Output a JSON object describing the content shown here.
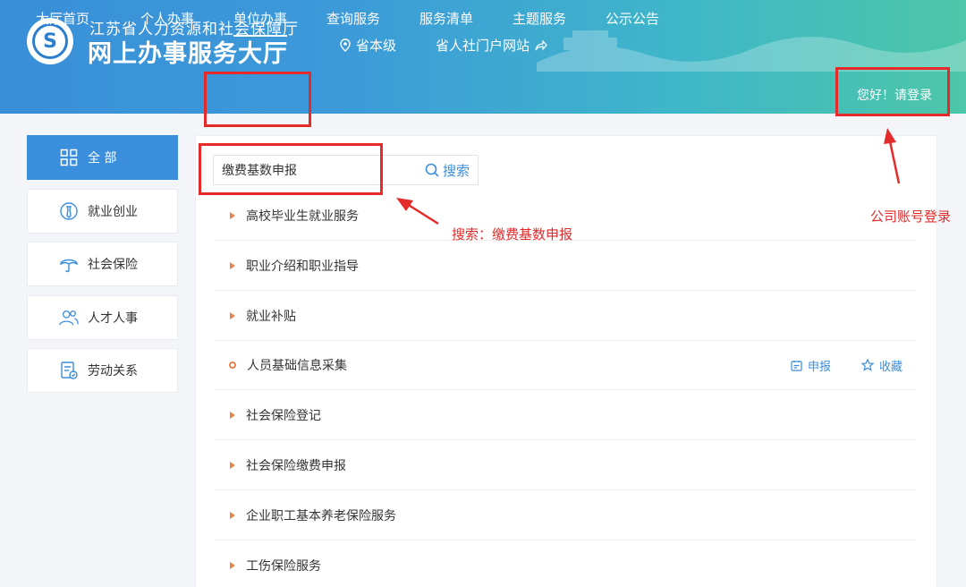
{
  "header": {
    "title_small": "江苏省人力资源和社会保障厅",
    "title_big": "网上办事服务大厅",
    "region": "省本级",
    "portal": "省人社门户网站",
    "login": "您好！请登录"
  },
  "nav": {
    "items": [
      "大厅首页",
      "个人办事",
      "单位办事",
      "查询服务",
      "服务清单",
      "主题服务",
      "公示公告"
    ],
    "active": "单位办事"
  },
  "sidebar": {
    "items": [
      {
        "label": "全 部",
        "icon": "grid-icon",
        "active": true
      },
      {
        "label": "就业创业",
        "icon": "employment-icon",
        "active": false
      },
      {
        "label": "社会保险",
        "icon": "umbrella-icon",
        "active": false
      },
      {
        "label": "人才人事",
        "icon": "people-icon",
        "active": false
      },
      {
        "label": "劳动关系",
        "icon": "document-icon",
        "active": false
      }
    ]
  },
  "search": {
    "value": "缴费基数申报",
    "button": "搜索"
  },
  "list": {
    "items": [
      {
        "label": "高校毕业生就业服务",
        "expandable": true
      },
      {
        "label": "职业介绍和职业指导",
        "expandable": true
      },
      {
        "label": "就业补贴",
        "expandable": true
      },
      {
        "label": "人员基础信息采集",
        "expandable": false,
        "actions": [
          "申报",
          "收藏"
        ]
      },
      {
        "label": "社会保险登记",
        "expandable": true
      },
      {
        "label": "社会保险缴费申报",
        "expandable": true
      },
      {
        "label": "企业职工基本养老保险服务",
        "expandable": true
      },
      {
        "label": "工伤保险服务",
        "expandable": true
      }
    ]
  },
  "annotations": {
    "search_note": "搜索：缴费基数申报",
    "login_note": "公司账号登录",
    "color": "#e52a2a"
  },
  "colors": {
    "accent": "#3b8edb",
    "bullet": "#e1874a"
  }
}
